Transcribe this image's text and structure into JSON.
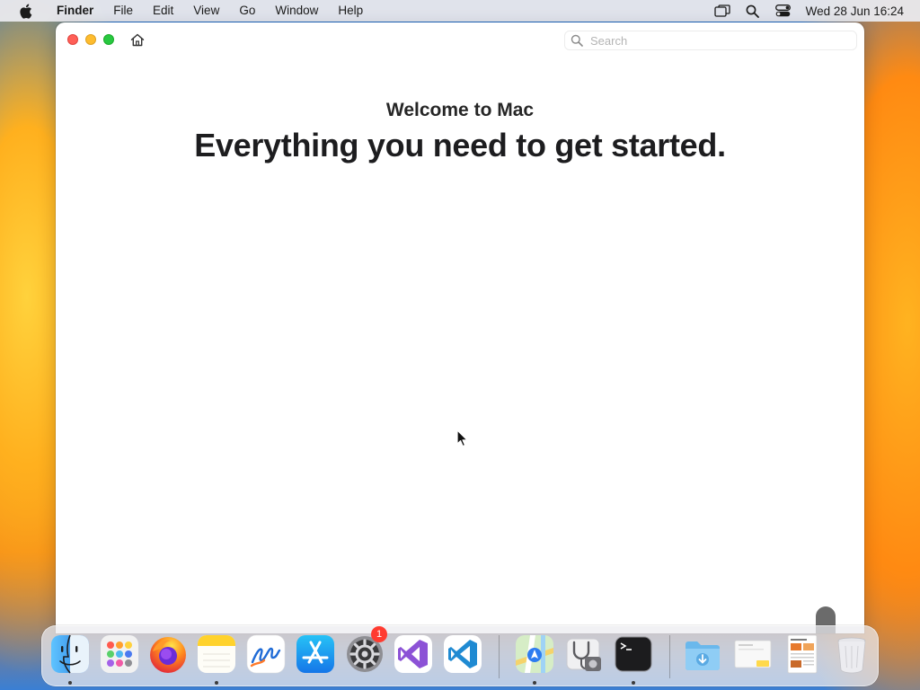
{
  "menubar": {
    "app_name": "Finder",
    "menus": [
      "File",
      "Edit",
      "View",
      "Go",
      "Window",
      "Help"
    ],
    "clock": "Wed 28 Jun  16:24"
  },
  "window": {
    "search_placeholder": "Search",
    "welcome_text": "Welcome to Mac",
    "headline": "Everything you need to get started."
  },
  "dock": {
    "apps": [
      {
        "name": "Finder",
        "icon": "finder-icon",
        "running": true
      },
      {
        "name": "Launchpad",
        "icon": "launchpad-icon",
        "running": false
      },
      {
        "name": "Firefox",
        "icon": "firefox-icon",
        "running": false
      },
      {
        "name": "Notes",
        "icon": "notes-icon",
        "running": true
      },
      {
        "name": "Freeform",
        "icon": "freeform-icon",
        "running": false
      },
      {
        "name": "App Store",
        "icon": "app-store-icon",
        "running": false
      },
      {
        "name": "System Settings",
        "icon": "system-settings-icon",
        "running": false,
        "badge": "1"
      },
      {
        "name": "Visual Studio",
        "icon": "visual-studio-icon",
        "running": false
      },
      {
        "name": "Visual Studio Code",
        "icon": "vscode-icon",
        "running": false
      },
      {
        "name": "Maps",
        "icon": "maps-icon",
        "running": true
      },
      {
        "name": "Disk Utility",
        "icon": "disk-utility-icon",
        "running": false
      },
      {
        "name": "Terminal",
        "icon": "terminal-icon",
        "running": true
      },
      {
        "name": "Downloads",
        "icon": "downloads-folder-icon",
        "running": false
      },
      {
        "name": "Document",
        "icon": "document-stack-icon",
        "running": false
      },
      {
        "name": "Preview",
        "icon": "document-preview-icon",
        "running": false
      },
      {
        "name": "Trash",
        "icon": "trash-icon",
        "running": false
      }
    ]
  },
  "colors": {
    "close": "#ff5f57",
    "minimize": "#febc2e",
    "maximize": "#28c840",
    "badge": "#ff3b30"
  }
}
